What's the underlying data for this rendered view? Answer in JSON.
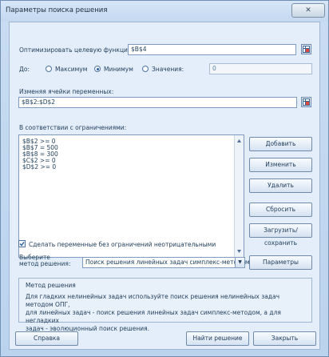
{
  "window": {
    "title": "Параметры поиска решения",
    "close_glyph": "✕"
  },
  "objective": {
    "label": "Оптимизировать целевую функцию:",
    "value": "$B$4"
  },
  "to": {
    "label": "До:",
    "options": [
      "Максимум",
      "Минимум",
      "Значения:"
    ],
    "selected": "Минимум",
    "value": "0"
  },
  "variables": {
    "label": "Изменяя ячейки переменных:",
    "value": "$B$2:$D$2"
  },
  "constraints": {
    "label": "В соответствии с ограничениями:",
    "items": [
      "$B$2 >= 0",
      "$B$7 = 500",
      "$B$8 = 300",
      "$C$2 >= 0",
      "$D$2 >= 0"
    ]
  },
  "side_buttons": {
    "add": "Добавить",
    "change": "Изменить",
    "delete": "Удалить",
    "reset": "Сбросить",
    "load_save": "Загрузить/сохранить"
  },
  "nonneg": {
    "label": "Сделать переменные без ограничений неотрицательными",
    "checked": true
  },
  "method": {
    "label_line1": "Выберите",
    "label_line2": "метод решения:",
    "selected": "Поиск решения линейных задач симплекс-методом",
    "params_button": "Параметры"
  },
  "method_info": {
    "title": "Метод решения",
    "text": "Для гладких нелинейных задач используйте поиск решения нелинейных задач методом ОПГ,\nдля линейных задач - поиск решения линейных задач симплекс-методом, а для негладких\nзадач - эволюционный поиск решения."
  },
  "footer": {
    "help": "Справка",
    "solve": "Найти решение",
    "close": "Закрыть"
  },
  "colors": {
    "background": "#cfe0f3",
    "client": "#e4eefa",
    "text": "#1e3d5a"
  },
  "icons": [
    "close-icon",
    "cell-reference-icon",
    "scroll-up-icon",
    "scroll-down-icon",
    "dropdown-arrow-icon",
    "checkmark-icon"
  ]
}
